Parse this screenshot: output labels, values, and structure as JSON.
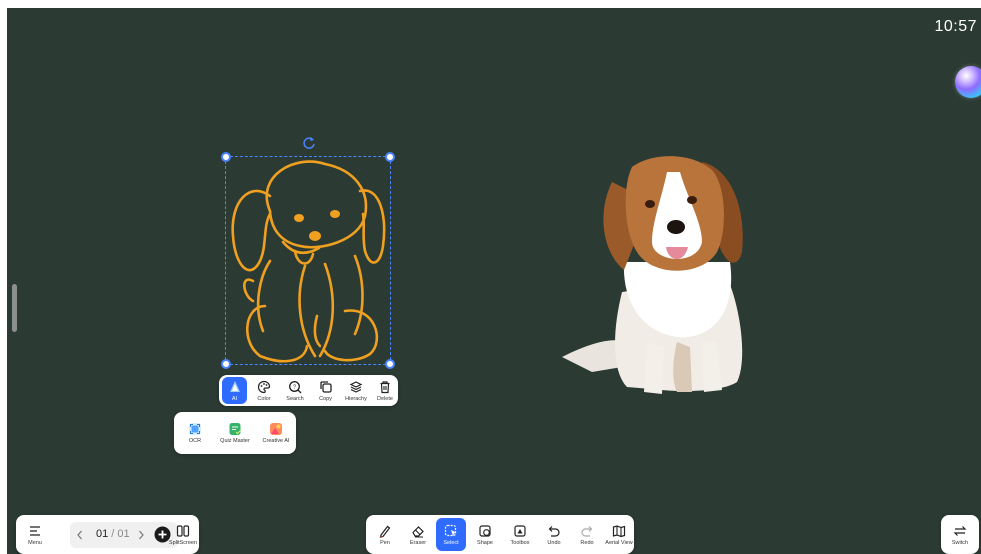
{
  "status": {
    "clock": "10:57"
  },
  "context_toolbar": {
    "items": [
      {
        "label": "AI",
        "icon": "ai-icon",
        "active": true
      },
      {
        "label": "Color",
        "icon": "palette-icon"
      },
      {
        "label": "Search",
        "icon": "search-icon"
      },
      {
        "label": "Copy",
        "icon": "copy-icon"
      },
      {
        "label": "Hierachy",
        "icon": "layers-icon"
      },
      {
        "label": "Delete",
        "icon": "trash-icon"
      }
    ]
  },
  "ai_submenu": {
    "items": [
      {
        "label": "OCR",
        "icon": "ocr-icon",
        "color": "#4da3ff"
      },
      {
        "label": "Quiz Master",
        "icon": "quiz-icon",
        "color": "#35b36b"
      },
      {
        "label": "Creative AI",
        "icon": "creative-ai-icon",
        "color": "#ff6a4d"
      }
    ]
  },
  "bottom_left": {
    "menu_label": "Menu",
    "page_current": "01",
    "page_separator": " / ",
    "page_total": "01",
    "split_label": "SplitScreen"
  },
  "bottom_toolbar": {
    "items": [
      {
        "label": "Pen",
        "icon": "pen-icon"
      },
      {
        "label": "Eraser",
        "icon": "eraser-icon"
      },
      {
        "label": "Select",
        "icon": "select-icon",
        "active": true
      },
      {
        "label": "Shape",
        "icon": "shape-icon"
      },
      {
        "label": "Toolbox",
        "icon": "toolbox-icon"
      },
      {
        "label": "Undo",
        "icon": "undo-icon"
      },
      {
        "label": "Redo",
        "icon": "redo-icon"
      },
      {
        "label": "Aerial View",
        "icon": "map-icon"
      }
    ]
  },
  "bottom_right": {
    "switch_label": "Switch"
  },
  "colors": {
    "board": "#2b3a33",
    "accent": "#2f6bff",
    "drawing": "#f0a020"
  }
}
